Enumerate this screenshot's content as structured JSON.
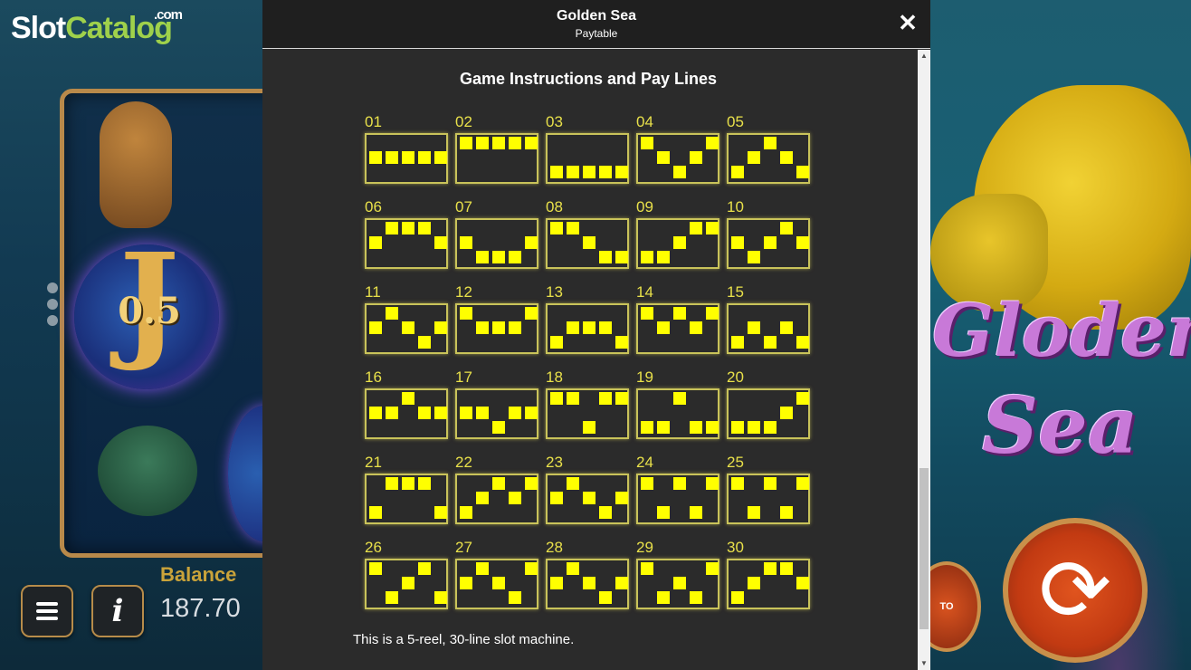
{
  "brand": {
    "slot": "Slot",
    "catalog": "Catalog",
    "com": ".com"
  },
  "game": {
    "symbol_letter": "J",
    "symbol_value": "0.5",
    "title_line1": "Gloden",
    "title_line2": "Sea",
    "balance_label": "Balance",
    "balance_value": "187.70",
    "auto_label": "TO",
    "info_label": "i",
    "spin_symbol": "⟳"
  },
  "modal": {
    "title": "Golden Sea",
    "subtitle": "Paytable",
    "close_label": "✕",
    "section_title": "Game Instructions and Pay Lines",
    "footer_text": "This is a 5-reel, 30-line slot machine."
  },
  "paylines": [
    {
      "num": "01",
      "rows": [
        1,
        1,
        1,
        1,
        1
      ]
    },
    {
      "num": "02",
      "rows": [
        0,
        0,
        0,
        0,
        0
      ]
    },
    {
      "num": "03",
      "rows": [
        2,
        2,
        2,
        2,
        2
      ]
    },
    {
      "num": "04",
      "rows": [
        0,
        1,
        2,
        1,
        0
      ]
    },
    {
      "num": "05",
      "rows": [
        2,
        1,
        0,
        1,
        2
      ]
    },
    {
      "num": "06",
      "rows": [
        1,
        0,
        0,
        0,
        1
      ]
    },
    {
      "num": "07",
      "rows": [
        1,
        2,
        2,
        2,
        1
      ]
    },
    {
      "num": "08",
      "rows": [
        0,
        0,
        1,
        2,
        2
      ]
    },
    {
      "num": "09",
      "rows": [
        2,
        2,
        1,
        0,
        0
      ]
    },
    {
      "num": "10",
      "rows": [
        1,
        2,
        1,
        0,
        1
      ]
    },
    {
      "num": "11",
      "rows": [
        1,
        0,
        1,
        2,
        1
      ]
    },
    {
      "num": "12",
      "rows": [
        0,
        1,
        1,
        1,
        0
      ]
    },
    {
      "num": "13",
      "rows": [
        2,
        1,
        1,
        1,
        2
      ]
    },
    {
      "num": "14",
      "rows": [
        0,
        1,
        0,
        1,
        0
      ]
    },
    {
      "num": "15",
      "rows": [
        2,
        1,
        2,
        1,
        2
      ]
    },
    {
      "num": "16",
      "rows": [
        1,
        1,
        0,
        1,
        1
      ]
    },
    {
      "num": "17",
      "rows": [
        1,
        1,
        2,
        1,
        1
      ]
    },
    {
      "num": "18",
      "rows": [
        0,
        0,
        2,
        0,
        0
      ]
    },
    {
      "num": "19",
      "rows": [
        2,
        2,
        0,
        2,
        2
      ]
    },
    {
      "num": "20",
      "rows": [
        2,
        2,
        2,
        1,
        0
      ]
    },
    {
      "num": "21",
      "rows": [
        2,
        0,
        0,
        0,
        2
      ]
    },
    {
      "num": "22",
      "rows": [
        2,
        1,
        0,
        1,
        0
      ]
    },
    {
      "num": "23",
      "rows": [
        1,
        0,
        1,
        2,
        1
      ]
    },
    {
      "num": "24",
      "rows": [
        0,
        2,
        0,
        2,
        0
      ]
    },
    {
      "num": "25",
      "rows": [
        0,
        2,
        0,
        2,
        0
      ]
    },
    {
      "num": "26",
      "rows": [
        0,
        2,
        1,
        0,
        2
      ]
    },
    {
      "num": "27",
      "rows": [
        1,
        0,
        1,
        2,
        0
      ]
    },
    {
      "num": "28",
      "rows": [
        1,
        0,
        1,
        2,
        1
      ]
    },
    {
      "num": "29",
      "rows": [
        0,
        2,
        1,
        2,
        0
      ]
    },
    {
      "num": "30",
      "rows": [
        2,
        1,
        0,
        0,
        1
      ]
    }
  ],
  "colors": {
    "line_cell": "#ffff00",
    "line_border": "#c9c35a",
    "line_number": "#e8e04a"
  }
}
